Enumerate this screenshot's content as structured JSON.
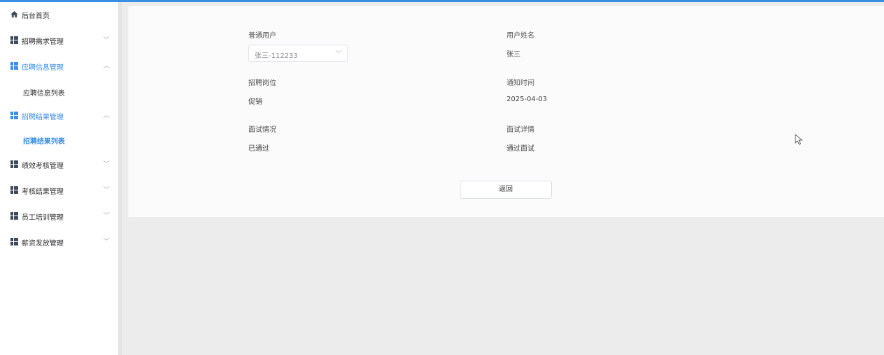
{
  "sidebar": {
    "items": [
      {
        "label": "后台首页",
        "icon": "home-icon",
        "has_arrow": false
      },
      {
        "label": "招聘需求管理",
        "icon": "grid-icon",
        "arrow": "﹀"
      },
      {
        "label": "应聘信息管理",
        "icon": "grid-icon",
        "arrow": "︿",
        "active": true
      },
      {
        "label": "应聘信息列表",
        "sub": true
      },
      {
        "label": "招聘结果管理",
        "icon": "grid-icon",
        "arrow": "︿",
        "active": true
      },
      {
        "label": "招聘结果列表",
        "sub": true,
        "active": true
      },
      {
        "label": "绩效考核管理",
        "icon": "grid-icon",
        "arrow": "﹀"
      },
      {
        "label": "考核结果管理",
        "icon": "grid-icon",
        "arrow": "﹀"
      },
      {
        "label": "员工培训管理",
        "icon": "grid-icon",
        "arrow": "﹀"
      },
      {
        "label": "薪资发放管理",
        "icon": "grid-icon",
        "arrow": "﹀"
      }
    ]
  },
  "form": {
    "user_label": "普通用户",
    "user_select_value": "张三-112233",
    "name_label": "用户姓名",
    "name_value": "张三",
    "position_label": "招聘岗位",
    "position_value": "促销",
    "notify_time_label": "通知时间",
    "notify_time_value": "2025-04-03",
    "interview_status_label": "面试情况",
    "interview_status_value": "已通过",
    "interview_detail_label": "面试详情",
    "interview_detail_value": "通过面试"
  },
  "actions": {
    "back_label": "返回"
  },
  "colors": {
    "accent": "#3a8ee6",
    "sidebar_bg": "#ffffff",
    "content_bg": "#ececec"
  }
}
